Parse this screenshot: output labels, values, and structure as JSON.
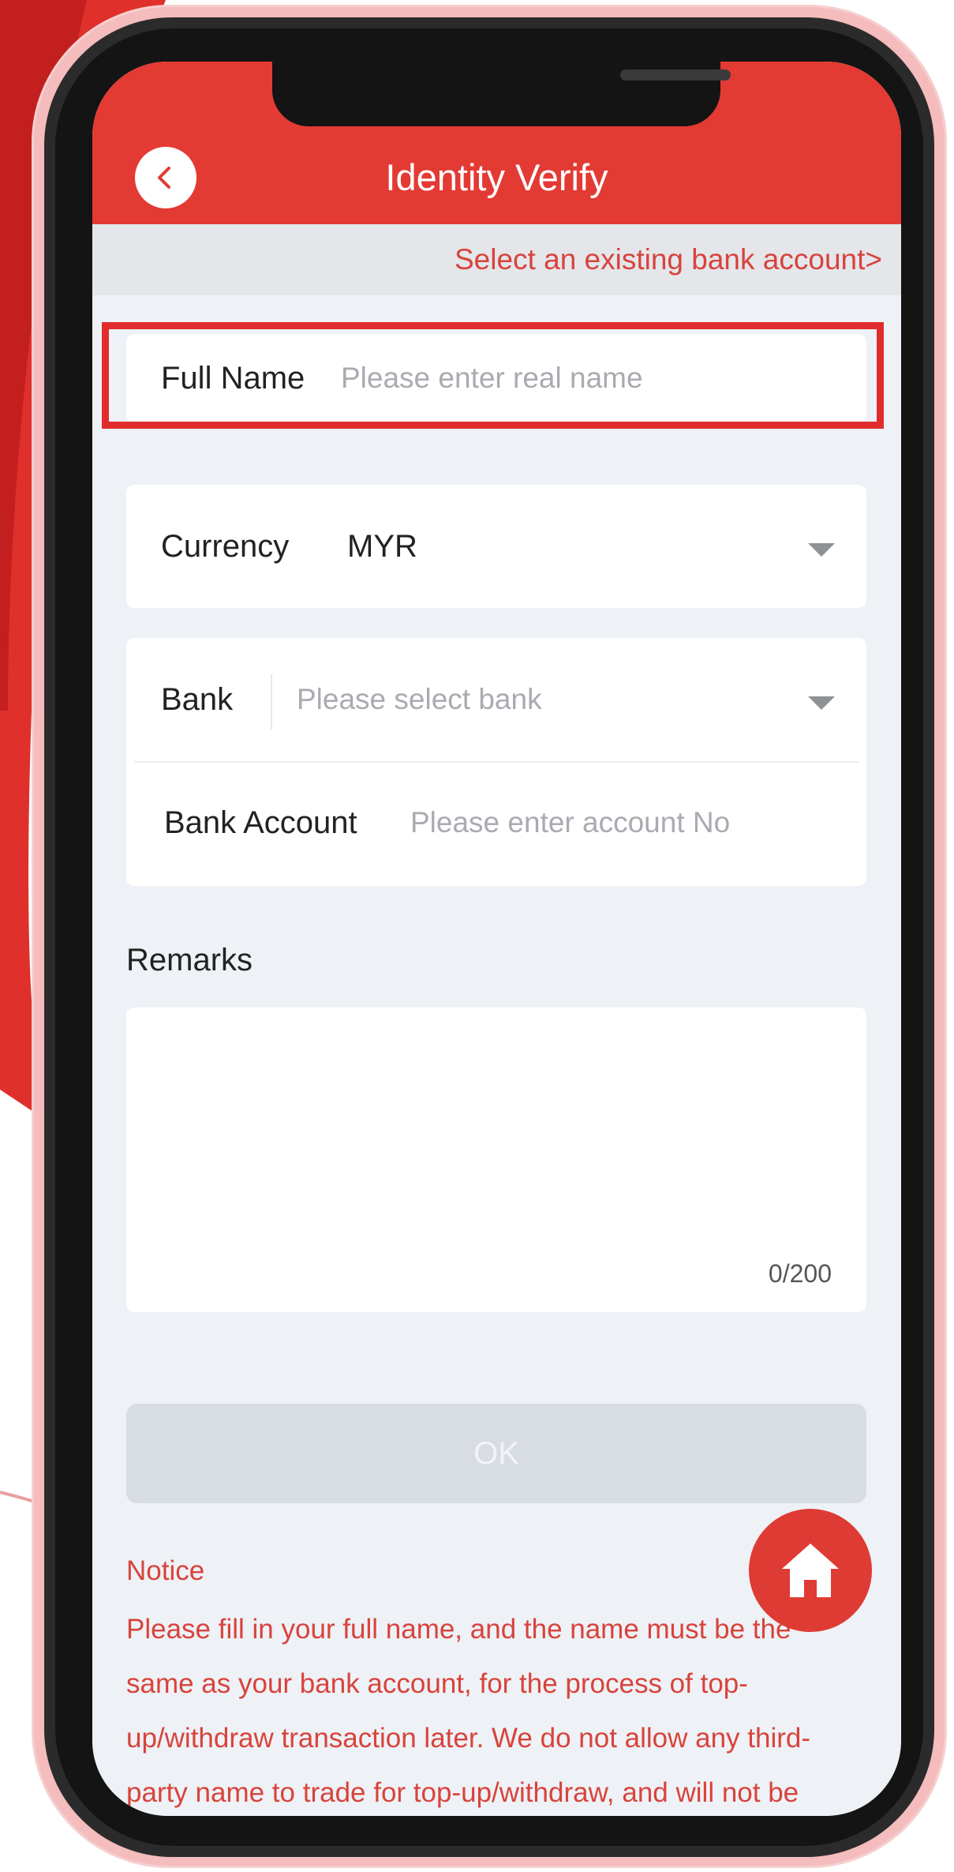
{
  "header": {
    "title": "Identity Verify"
  },
  "existing_account": {
    "link_text": "Select an existing bank account>"
  },
  "form": {
    "full_name": {
      "label": "Full Name",
      "placeholder": "Please enter real name"
    },
    "currency": {
      "label": "Currency",
      "value": "MYR"
    },
    "bank": {
      "label": "Bank",
      "placeholder": "Please select bank"
    },
    "bank_account": {
      "label": "Bank Account",
      "placeholder": "Please enter account No"
    },
    "remarks": {
      "label": "Remarks",
      "counter": "0/200"
    },
    "ok_label": "OK"
  },
  "notice": {
    "title": "Notice",
    "text": "Please fill in your full name, and the name must be the same as your bank account, for the process of top-up/withdraw transaction later. We do not allow any third-party name to trade for top-up/withdraw, and will not be"
  },
  "colors": {
    "accent": "#e33a34",
    "highlight_border": "#e02c2c",
    "notice_text": "#d8433c",
    "screen_background": "#eef1f5",
    "ok_disabled": "#d8dce3"
  },
  "icons": {
    "back": "chevron-left-icon",
    "dropdown": "caret-down-icon",
    "home": "home-icon"
  }
}
